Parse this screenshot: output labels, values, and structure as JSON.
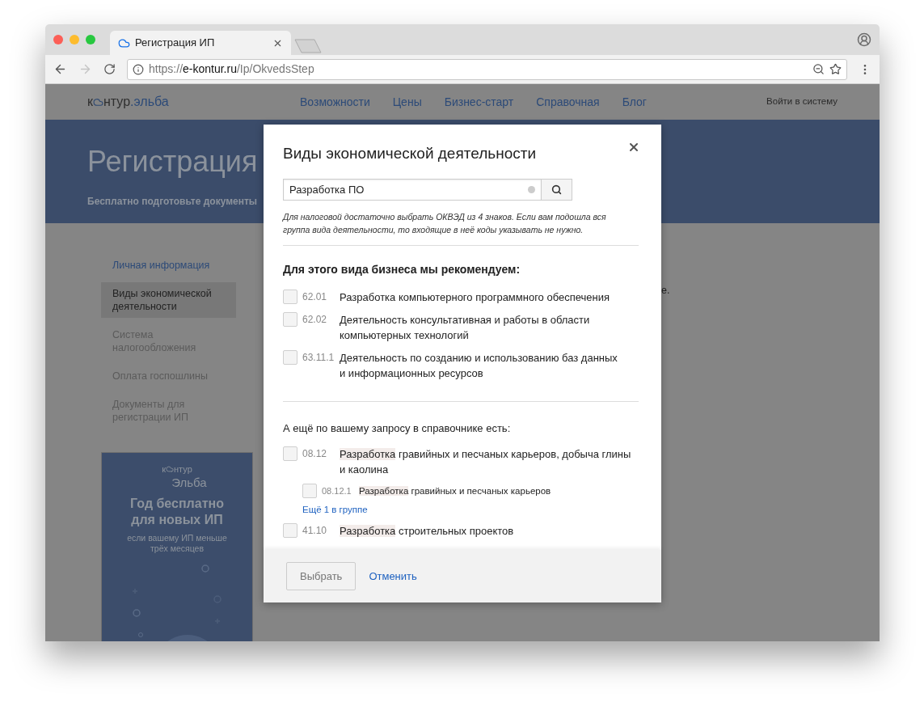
{
  "browser": {
    "tab": {
      "title": "Регистрация ИП",
      "selected": true
    },
    "url": {
      "scheme": "https://",
      "host": "e-kontur.ru",
      "path": "/Ip/OkvedsStep"
    },
    "forward_disabled": true
  },
  "site_nav": {
    "logo": {
      "before": "к",
      "after": "нтур",
      "suffix": ".эльба"
    },
    "links": [
      "Возможности",
      "Цены",
      "Бизнес-старт",
      "Справочная",
      "Блог"
    ],
    "login": "Войти в систему"
  },
  "header": {
    "title": "Регистрация",
    "subtitle": "Бесплатно подготовьте документы"
  },
  "sidebar": {
    "items": [
      {
        "label": "Личная информация",
        "selected": false,
        "enabled": true
      },
      {
        "label": "Виды экономической деятельности",
        "selected": true,
        "enabled": true
      },
      {
        "label": "Система налогообложения",
        "selected": false,
        "enabled": false
      },
      {
        "label": "Оплата госпошлины",
        "selected": false,
        "enabled": false
      },
      {
        "label": "Документы для регистрации ИП",
        "selected": false,
        "enabled": false
      }
    ]
  },
  "promo": {
    "logo_before": "к",
    "logo_after": "нтур",
    "logo_name": "Эльба",
    "title": "Год бесплатно для новых ИП",
    "text": "если вашему ИП меньше трёх месяцев"
  },
  "main_fragment": "е.",
  "modal": {
    "title": "Виды экономической деятельности",
    "search": {
      "value": "Разработка ПО"
    },
    "hint": "Для налоговой достаточно выбрать ОКВЭД из 4 знаков. Если вам подошла вся группа вида деятельности, то входящие в неё коды указывать не нужно.",
    "recommended_heading": "Для этого вида бизнеса мы рекомендуем:",
    "recommended": [
      {
        "code": "62.01",
        "name": "Разработка компьютерного программного обеспечения",
        "checked": false
      },
      {
        "code": "62.02",
        "name": "Деятельность консультативная и работы в области компьютерных технологий",
        "checked": false
      },
      {
        "code": "63.11.1",
        "name": "Деятельность по созданию и использованию баз данных и информационных ресурсов",
        "checked": false
      }
    ],
    "more_heading": "А ещё по вашему запросу в справочнике есть:",
    "results": [
      {
        "code": "08.12",
        "match": "Разработка",
        "text": "гравийных и песчаных карьеров, добыча глины и каолина",
        "checked": false,
        "children": [
          {
            "code": "08.12.1",
            "match": "Разработка",
            "text": "гравийных и песчаных карьеров",
            "checked": false
          }
        ],
        "more_link": "Ещё 1 в группе"
      },
      {
        "code": "41.10",
        "match": "Разработка",
        "text": "строительных проектов",
        "checked": false
      }
    ],
    "buttons": {
      "primary": "Выбрать",
      "cancel": "Отменить"
    }
  }
}
